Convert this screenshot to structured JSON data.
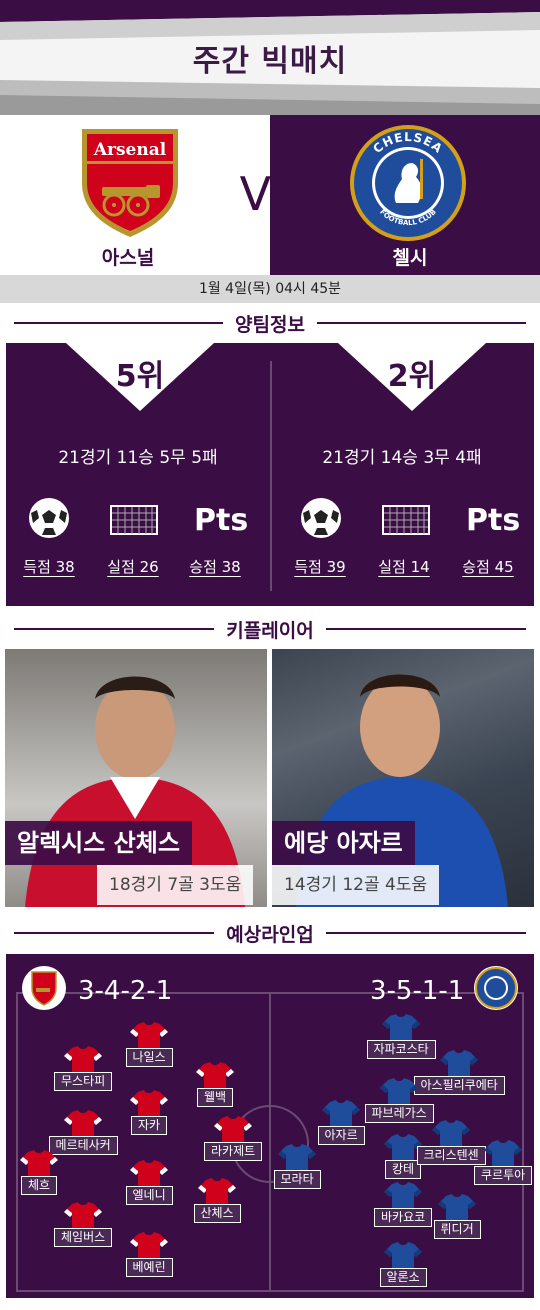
{
  "header": {
    "title": "주간 빅매치"
  },
  "match": {
    "home": {
      "name": "아스널",
      "crest_text": "Arsenal"
    },
    "away": {
      "name": "첼시",
      "crest_text": "CHELSEA",
      "crest_sub": "FOOTBALL CLUB"
    },
    "vs": "VS",
    "datetime": "1월 4일(목) 04시 45분"
  },
  "team_info": {
    "heading": "양팀정보",
    "home": {
      "rank": "5위",
      "record": "21경기 11승 5무 5패",
      "goals": "득점 38",
      "conceded": "실점 26",
      "points": "승점 38"
    },
    "away": {
      "rank": "2위",
      "record": "21경기 14승 3무 4패",
      "goals": "득점 39",
      "conceded": "실점 14",
      "points": "승점 45"
    },
    "pts_icon": "Pts"
  },
  "key_players": {
    "heading": "키플레이어",
    "home": {
      "name": "알렉시스 산체스",
      "stat": "18경기 7골 3도움"
    },
    "away": {
      "name": "에당 아자르",
      "stat": "14경기 12골 4도움"
    }
  },
  "lineup": {
    "heading": "예상라인업",
    "home_formation": "3-4-2-1",
    "away_formation": "3-5-1-1",
    "home_players": [
      "나일스",
      "무스타피",
      "웰백",
      "자카",
      "메르테사커",
      "라카제트",
      "체흐",
      "엘네니",
      "산체스",
      "체임버스",
      "베예린"
    ],
    "away_players": [
      "자파코스타",
      "아스필리쿠에타",
      "파브레가스",
      "아자르",
      "모라타",
      "캉테",
      "크리스텐센",
      "쿠르투아",
      "바카요코",
      "뤼디거",
      "알론소"
    ]
  },
  "colors": {
    "brand_purple": "#3a0d45",
    "arsenal_red": "#d0021b",
    "chelsea_blue": "#1f4d9c"
  }
}
